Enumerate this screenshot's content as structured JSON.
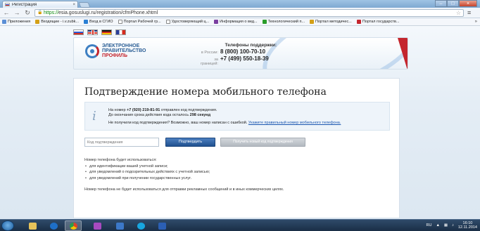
{
  "browser": {
    "tab_title": "Регистрация",
    "tab_close": "×",
    "window_buttons": [
      "–",
      "□",
      "×"
    ],
    "url_scheme": "https://",
    "url_rest": "esia.gosuslugi.ru/registration/cfmPhone.xhtml",
    "bookmarks": [
      {
        "label": "Приложения",
        "color": "#5b8fd6"
      },
      {
        "label": "Входящие - i.v.zubk...",
        "color": "#d4a017"
      },
      {
        "label": "Вход в СГИО",
        "color": "#2a7fd4"
      },
      {
        "label": "Портал Рабочей гр...",
        "color": "#888888"
      },
      {
        "label": "Удостоверяющий ц...",
        "color": "#888888"
      },
      {
        "label": "Информация о вед...",
        "color": "#7a3fa0"
      },
      {
        "label": "Технологический п...",
        "color": "#2a9d2a"
      },
      {
        "label": "Портал методичес...",
        "color": "#d4a017"
      },
      {
        "label": "Портал государств...",
        "color": "#c4262e"
      }
    ],
    "bookmarks_more": "»"
  },
  "header": {
    "languages": [
      "ru",
      "en",
      "de",
      "fr"
    ],
    "logo_line1": "ЭЛЕКТРОННОЕ",
    "logo_line2": "ПРАВИТЕЛЬСТВО",
    "logo_line3": "ПРОФИЛЬ",
    "support_title": "Телефоны поддержки:",
    "support_ru_label": "в России:",
    "support_ru_number": "8 (800) 100-70-10",
    "support_abroad_label": "за границей:",
    "support_abroad_number": "+7 (499) 550-18-39"
  },
  "main": {
    "title": "Подтверждение номера мобильного телефона",
    "info_icon": "i",
    "info_prefix": "На номер",
    "phone": "+7 (920) 219-81-91",
    "info_suffix": "отправлен код подтверждения.",
    "timer_prefix": "До окончания срока действия кода осталось",
    "timer_value": "298 секунд",
    "wrong_number_text": "Не получили код подтверждения? Возможно, ваш номер написан с ошибкой.",
    "wrong_number_link": "Укажите правильный номер мобильного телефона.",
    "code_placeholder": "Код подтверждения",
    "confirm_button": "Подтвердить",
    "new_code_button": "Получить новый код подтверждения",
    "usage_heading": "Номер телефона будет использоваться:",
    "usage_items": [
      "для идентификации вашей учетной записи;",
      "для уведомлений о подозрительных действиях с учетной записью;",
      "для уведомлений при получении государственных услуг."
    ],
    "note": "Номер телефона не будет использоваться для отправки рекламных сообщений и в иных коммерческих целях."
  },
  "taskbar": {
    "apps": [
      {
        "icon": "folder-icon",
        "color": "#e6c25a"
      },
      {
        "icon": "teamviewer-icon",
        "color": "#1e6fc8"
      },
      {
        "icon": "chrome-icon",
        "color": "#d9442a"
      },
      {
        "icon": "archive-icon",
        "color": "#a84ac0"
      },
      {
        "icon": "network-icon",
        "color": "#3c78c8"
      },
      {
        "icon": "skype-icon",
        "color": "#17a6e0"
      },
      {
        "icon": "word-icon",
        "color": "#2b5fb4"
      }
    ],
    "language": "RU",
    "time": "16:10",
    "date": "12.11.2014"
  }
}
